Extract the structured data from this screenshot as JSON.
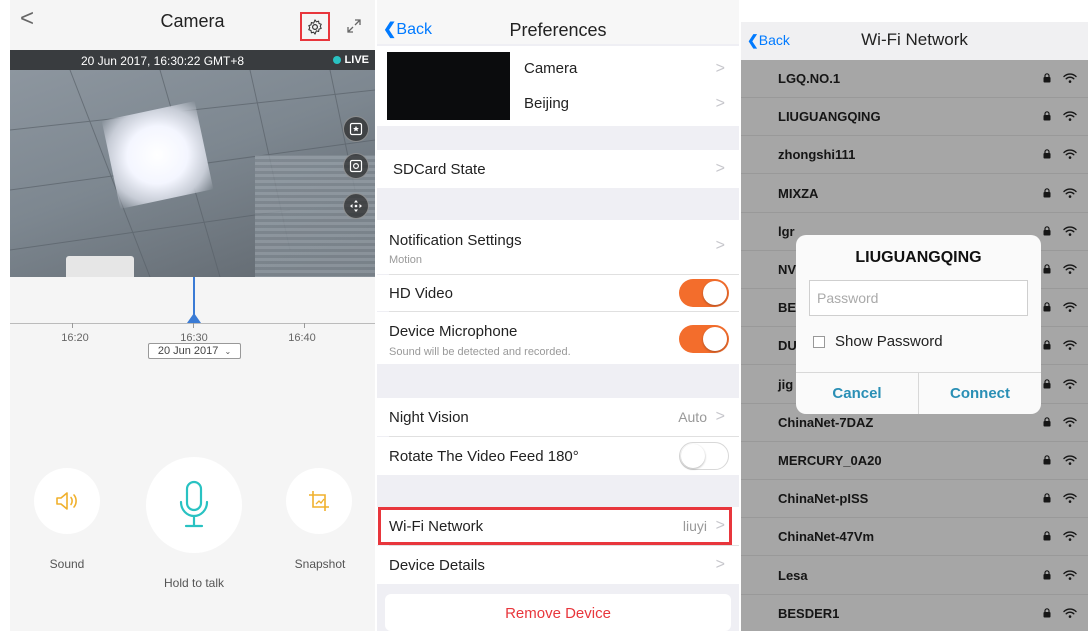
{
  "camera": {
    "back_glyph": "<",
    "title": "Camera",
    "timestamp": "20 Jun 2017, 16:30:22 GMT+8",
    "live": "LIVE",
    "ticks": [
      "16:20",
      "16:30",
      "16:40"
    ],
    "date_select": "20 Jun 2017",
    "sound_label": "Sound",
    "hold_label": "Hold to talk",
    "snapshot_label": "Snapshot",
    "accent": "#29c2c2",
    "highlight": "#e8363c"
  },
  "preferences": {
    "back_label": "Back",
    "title": "Preferences",
    "device_name": "Camera",
    "location": "Beijing",
    "sdcard": "SDCard State",
    "notification": "Notification Settings",
    "notification_sub": "Motion",
    "hd_video": "HD Video",
    "microphone": "Device Microphone",
    "microphone_sub": "Sound will be detected and recorded.",
    "night_vision": "Night Vision",
    "night_vision_value": "Auto",
    "rotate": "Rotate The Video Feed 180°",
    "wifi": "Wi-Fi Network",
    "wifi_value": "liuyi",
    "details": "Device Details",
    "remove": "Remove Device",
    "chevron": ">"
  },
  "wifi": {
    "back_label": "Back",
    "title": "Wi-Fi Network",
    "networks": [
      "LGQ.NO.1",
      "LIUGUANGQING",
      "zhongshi111",
      "MIXZA",
      "lgr",
      "NV",
      "BE",
      "DU",
      "jig",
      "ChinaNet-7DAZ",
      "MERCURY_0A20",
      "ChinaNet-pISS",
      "ChinaNet-47Vm",
      "Lesa",
      "BESDER1"
    ],
    "dialog": {
      "title": "LIUGUANGQING",
      "password_placeholder": "Password",
      "show_password": "Show Password",
      "cancel": "Cancel",
      "connect": "Connect"
    }
  }
}
